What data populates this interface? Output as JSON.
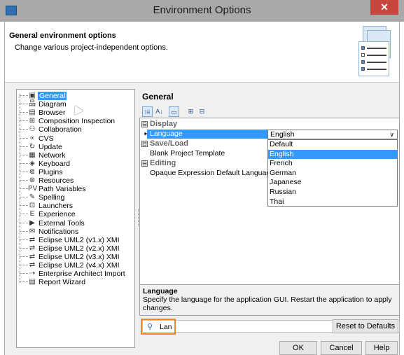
{
  "window": {
    "title": "Environment Options",
    "close_glyph": "✕",
    "icon": "app-icon"
  },
  "header": {
    "title": "General environment options",
    "description": "Change various project-independent options."
  },
  "tree": {
    "items": [
      {
        "label": "General",
        "icon": "general-icon",
        "glyph": "▣",
        "selected": true
      },
      {
        "label": "Diagram",
        "icon": "diagram-icon",
        "glyph": "品"
      },
      {
        "label": "Browser",
        "icon": "browser-icon",
        "glyph": "▤"
      },
      {
        "label": "Composition Inspection",
        "icon": "composition-icon",
        "glyph": "⊞"
      },
      {
        "label": "Collaboration",
        "icon": "collaboration-icon",
        "glyph": "⚇"
      },
      {
        "label": "CVS",
        "icon": "cvs-icon",
        "glyph": "∝"
      },
      {
        "label": "Update",
        "icon": "update-icon",
        "glyph": "↻"
      },
      {
        "label": "Network",
        "icon": "network-icon",
        "glyph": "▦"
      },
      {
        "label": "Keyboard",
        "icon": "keyboard-icon",
        "glyph": "◈"
      },
      {
        "label": "Plugins",
        "icon": "plugins-icon",
        "glyph": "⋐"
      },
      {
        "label": "Resources",
        "icon": "resources-icon",
        "glyph": "⊛"
      },
      {
        "label": "Path Variables",
        "icon": "path-variables-icon",
        "glyph": "PV"
      },
      {
        "label": "Spelling",
        "icon": "spelling-icon",
        "glyph": "✎"
      },
      {
        "label": "Launchers",
        "icon": "launchers-icon",
        "glyph": "⊡"
      },
      {
        "label": "Experience",
        "icon": "experience-icon",
        "glyph": "E"
      },
      {
        "label": "External Tools",
        "icon": "external-tools-icon",
        "glyph": "▶"
      },
      {
        "label": "Notifications",
        "icon": "notifications-icon",
        "glyph": "✉"
      },
      {
        "label": "Eclipse UML2 (v1.x) XMI",
        "icon": "xmi-icon",
        "glyph": "⇄"
      },
      {
        "label": "Eclipse UML2 (v2.x) XMI",
        "icon": "xmi-icon",
        "glyph": "⇄"
      },
      {
        "label": "Eclipse UML2 (v3.x) XMI",
        "icon": "xmi-icon",
        "glyph": "⇄"
      },
      {
        "label": "Eclipse UML2 (v4.x) XMI",
        "icon": "xmi-icon",
        "glyph": "⇄"
      },
      {
        "label": "Enterprise Architect Import",
        "icon": "ea-import-icon",
        "glyph": "⇢"
      },
      {
        "label": "Report Wizard",
        "icon": "report-wizard-icon",
        "glyph": "▤"
      }
    ]
  },
  "right": {
    "title": "General",
    "toolbar": [
      {
        "icon": "categorized-icon",
        "glyph": "⁝≡",
        "active": true
      },
      {
        "icon": "sort-alpha-icon",
        "glyph": "A↓",
        "active": false
      },
      {
        "icon": "description-toggle-icon",
        "glyph": "▭",
        "active": true
      },
      {
        "icon": "expand-all-icon",
        "glyph": "⊞",
        "active": false
      },
      {
        "icon": "collapse-all-icon",
        "glyph": "⊟",
        "active": false
      }
    ]
  },
  "grid": {
    "categories": [
      {
        "name": "Display",
        "toggle": "⊟"
      },
      {
        "name": "Save/Load",
        "toggle": "⊟"
      },
      {
        "name": "Editing",
        "toggle": "⊟"
      }
    ],
    "properties": [
      {
        "name": "Language",
        "value": "English",
        "selected": true,
        "arrow": "►"
      },
      {
        "name": "Blank Project Template",
        "value": ""
      },
      {
        "name": "Opaque Expression Default Language",
        "value": ""
      }
    ],
    "dropdown": {
      "selected": "English",
      "chevron": "∨",
      "options": [
        "Default",
        "English",
        "French",
        "German",
        "Japanese",
        "Russian",
        "Thai"
      ],
      "highlighted": "English"
    }
  },
  "description": {
    "title": "Language",
    "text": "Specify the language for the application GUI. Restart the application to apply changes."
  },
  "search": {
    "value": "Lan",
    "icon": "search-icon",
    "glyph": "⚲",
    "clear_glyph": "×"
  },
  "buttons": {
    "reset": "Reset to Defaults",
    "ok": "OK",
    "cancel": "Cancel",
    "help": "Help"
  }
}
